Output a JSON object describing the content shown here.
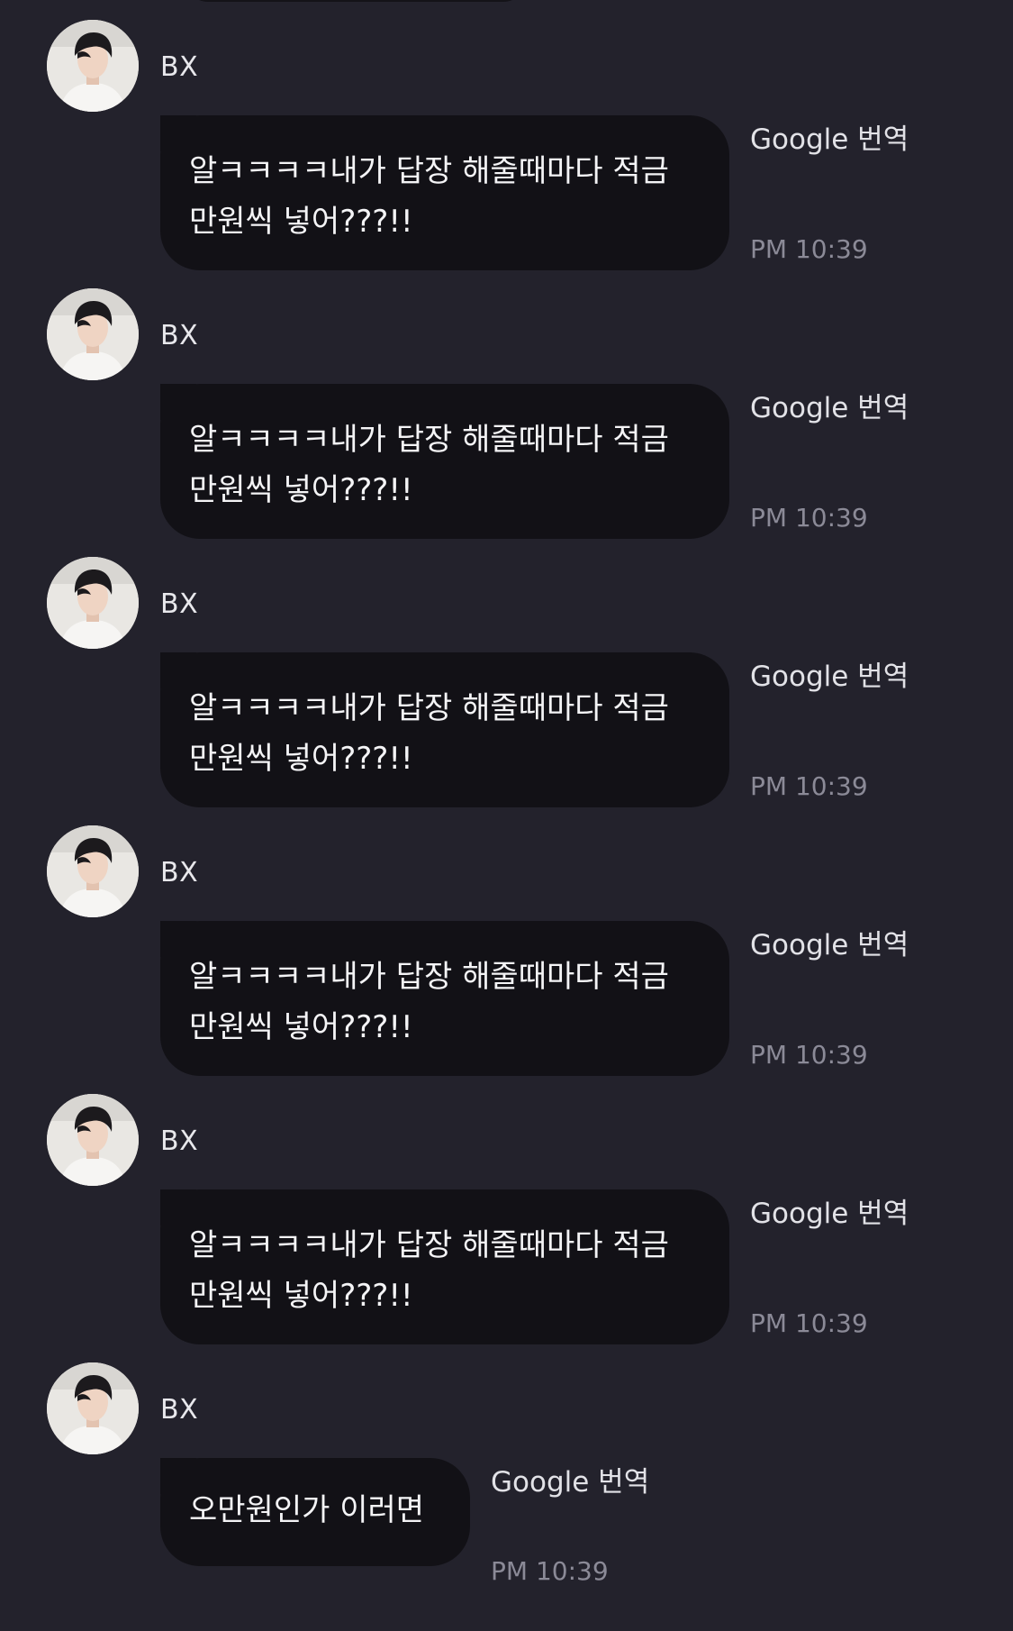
{
  "messages": [
    {
      "sender": "BX",
      "text": "알ㅋㅋㅋㅋ내가 답장 해줄때마다 적금 만원씩 넣어???!!",
      "translate_label": "Google 번역",
      "time": "PM 10:39",
      "avatar_icon": "profile-photo"
    },
    {
      "sender": "BX",
      "text": "알ㅋㅋㅋㅋ내가 답장 해줄때마다 적금 만원씩 넣어???!!",
      "translate_label": "Google 번역",
      "time": "PM 10:39",
      "avatar_icon": "profile-photo"
    },
    {
      "sender": "BX",
      "text": "알ㅋㅋㅋㅋ내가 답장 해줄때마다 적금 만원씩 넣어???!!",
      "translate_label": "Google 번역",
      "time": "PM 10:39",
      "avatar_icon": "profile-photo"
    },
    {
      "sender": "BX",
      "text": "알ㅋㅋㅋㅋ내가 답장 해줄때마다 적금 만원씩 넣어???!!",
      "translate_label": "Google 번역",
      "time": "PM 10:39",
      "avatar_icon": "profile-photo"
    },
    {
      "sender": "BX",
      "text": "알ㅋㅋㅋㅋ내가 답장 해줄때마다 적금 만원씩 넣어???!!",
      "translate_label": "Google 번역",
      "time": "PM 10:39",
      "avatar_icon": "profile-photo"
    },
    {
      "sender": "BX",
      "text": "오만원인가 이러면",
      "translate_label": "Google 번역",
      "time": "PM 10:39",
      "avatar_icon": "profile-photo"
    }
  ],
  "colors": {
    "background": "#23222c",
    "bubble": "#121116",
    "text": "#f4f4f6",
    "timestamp": "#8b8a97"
  }
}
